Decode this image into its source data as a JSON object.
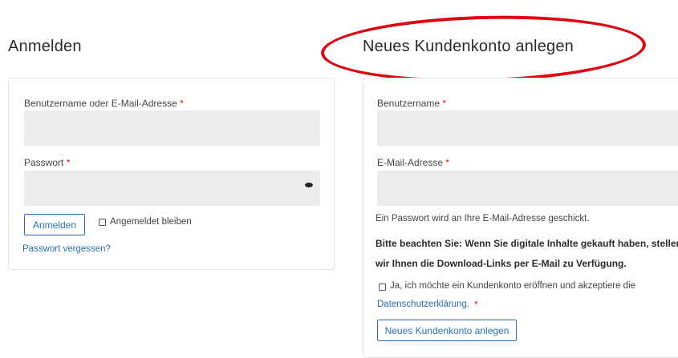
{
  "login": {
    "title": "Anmelden",
    "username_label": "Benutzername oder E-Mail-Adresse",
    "username_value": "",
    "password_label": "Passwort",
    "password_value": "",
    "required_mark": "*",
    "login_button": "Anmelden",
    "remember_label": "Angemeldet bleiben",
    "forgot_link": "Passwort vergessen?"
  },
  "register": {
    "title": "Neues Kundenkonto anlegen",
    "username_label": "Benutzername",
    "username_value": "",
    "email_label": "E-Mail-Adresse",
    "email_value": "",
    "required_mark": "*",
    "password_info": "Ein Passwort wird an Ihre E-Mail-Adresse geschickt.",
    "notice_line1": "Bitte beachten Sie: Wenn Sie digitale Inhalte gekauft haben, stellen",
    "notice_line2": "wir Ihnen die Download-Links per E-Mail zu Verfügung.",
    "consent_text": "Ja, ich möchte ein Kundenkonto eröffnen und akzeptiere die",
    "privacy_link": "Datenschutzerklärung.",
    "submit_button": "Neues Kundenkonto anlegen"
  },
  "annotation": {
    "ellipse_color": "#e0000f"
  },
  "icons": {
    "password_toggle": "eye-icon"
  },
  "colors": {
    "accent": "#2a6fb5",
    "required": "#e0101b",
    "field_bg": "#ececec"
  }
}
